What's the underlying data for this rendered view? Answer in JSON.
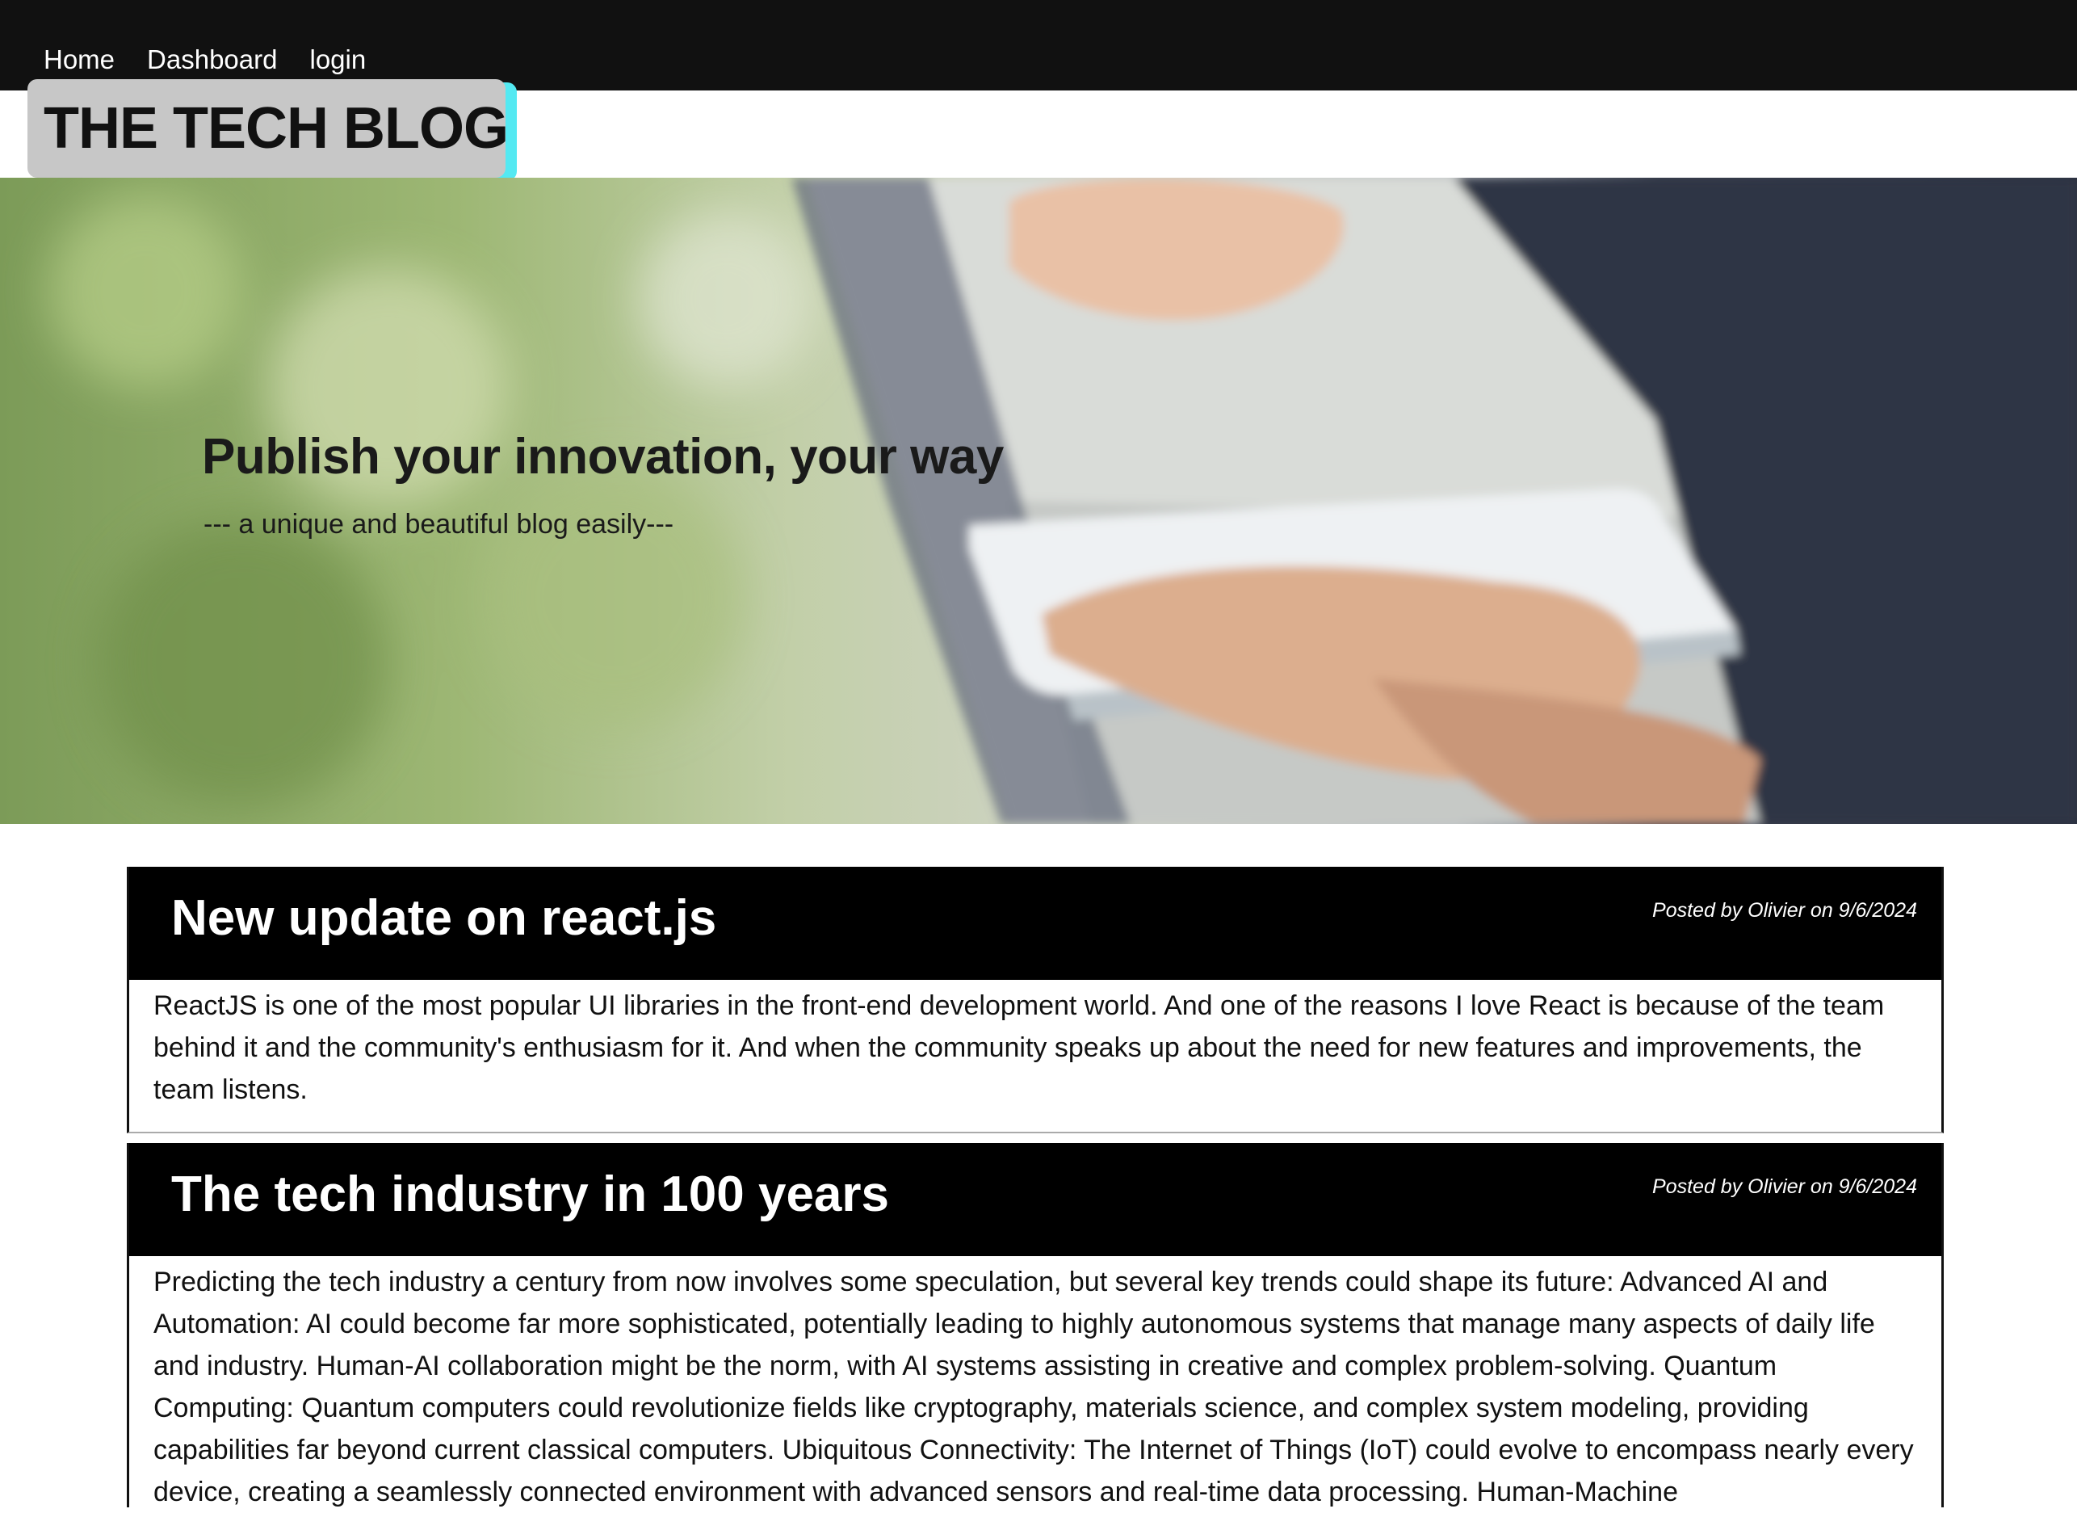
{
  "nav": {
    "items": [
      {
        "label": "Home"
      },
      {
        "label": "Dashboard"
      },
      {
        "label": "login"
      }
    ]
  },
  "brand": {
    "title": "THE TECH BLOG"
  },
  "hero": {
    "title": "Publish your innovation, your way",
    "subtitle": "--- a unique and beautiful blog easily---"
  },
  "posts": [
    {
      "title": "New update on react.js",
      "meta": "Posted by Olivier on 9/6/2024",
      "body": "ReactJS is one of the most popular UI libraries in the front-end development world. And one of the reasons I love React is because of the team behind it and the community's enthusiasm for it. And when the community speaks up about the need for new features and improvements, the team listens."
    },
    {
      "title": "The tech industry in 100 years",
      "meta": "Posted by Olivier on 9/6/2024",
      "body": "Predicting the tech industry a century from now involves some speculation, but several key trends could shape its future: Advanced AI and Automation: AI could become far more sophisticated, potentially leading to highly autonomous systems that manage many aspects of daily life and industry. Human-AI collaboration might be the norm, with AI systems assisting in creative and complex problem-solving. Quantum Computing: Quantum computers could revolutionize fields like cryptography, materials science, and complex system modeling, providing capabilities far beyond current classical computers. Ubiquitous Connectivity: The Internet of Things (IoT) could evolve to encompass nearly every device, creating a seamlessly connected environment with advanced sensors and real-time data processing. Human-Machine"
    }
  ]
}
